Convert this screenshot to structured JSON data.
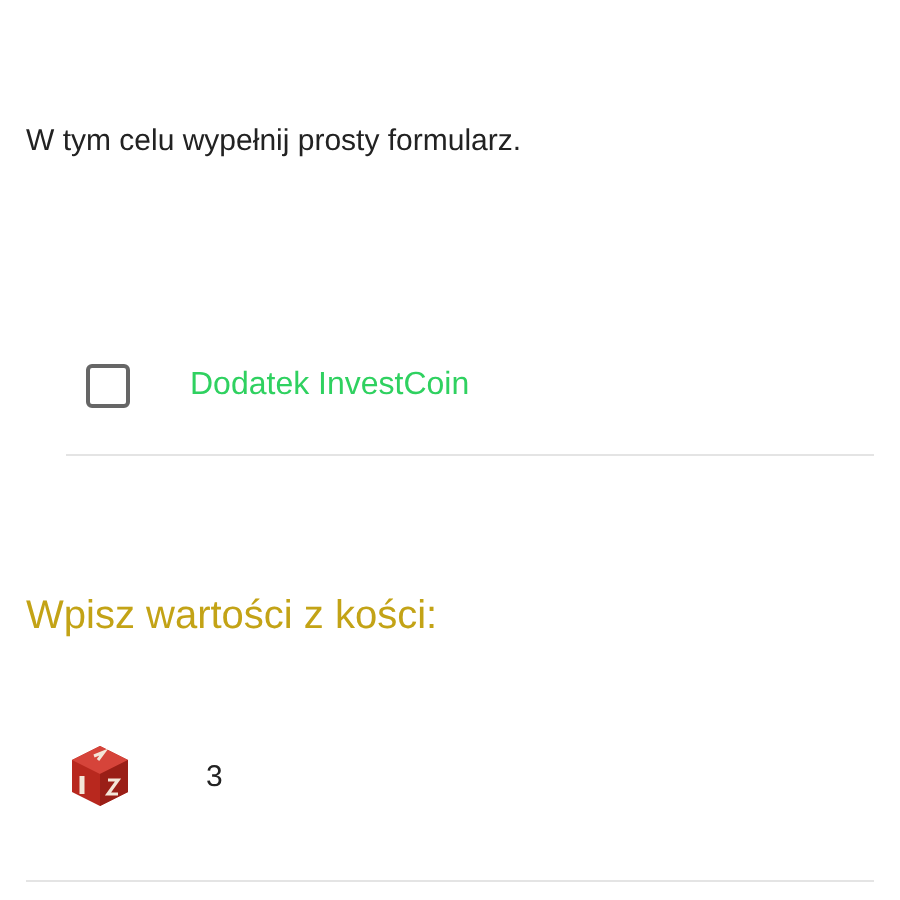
{
  "intro": "W tym celu wypełnij prosty formularz.",
  "addon": {
    "label": "Dodatek InvestCoin",
    "checked": false
  },
  "dice_heading": "Wpisz wartości z kości:",
  "dice_value": "3"
}
